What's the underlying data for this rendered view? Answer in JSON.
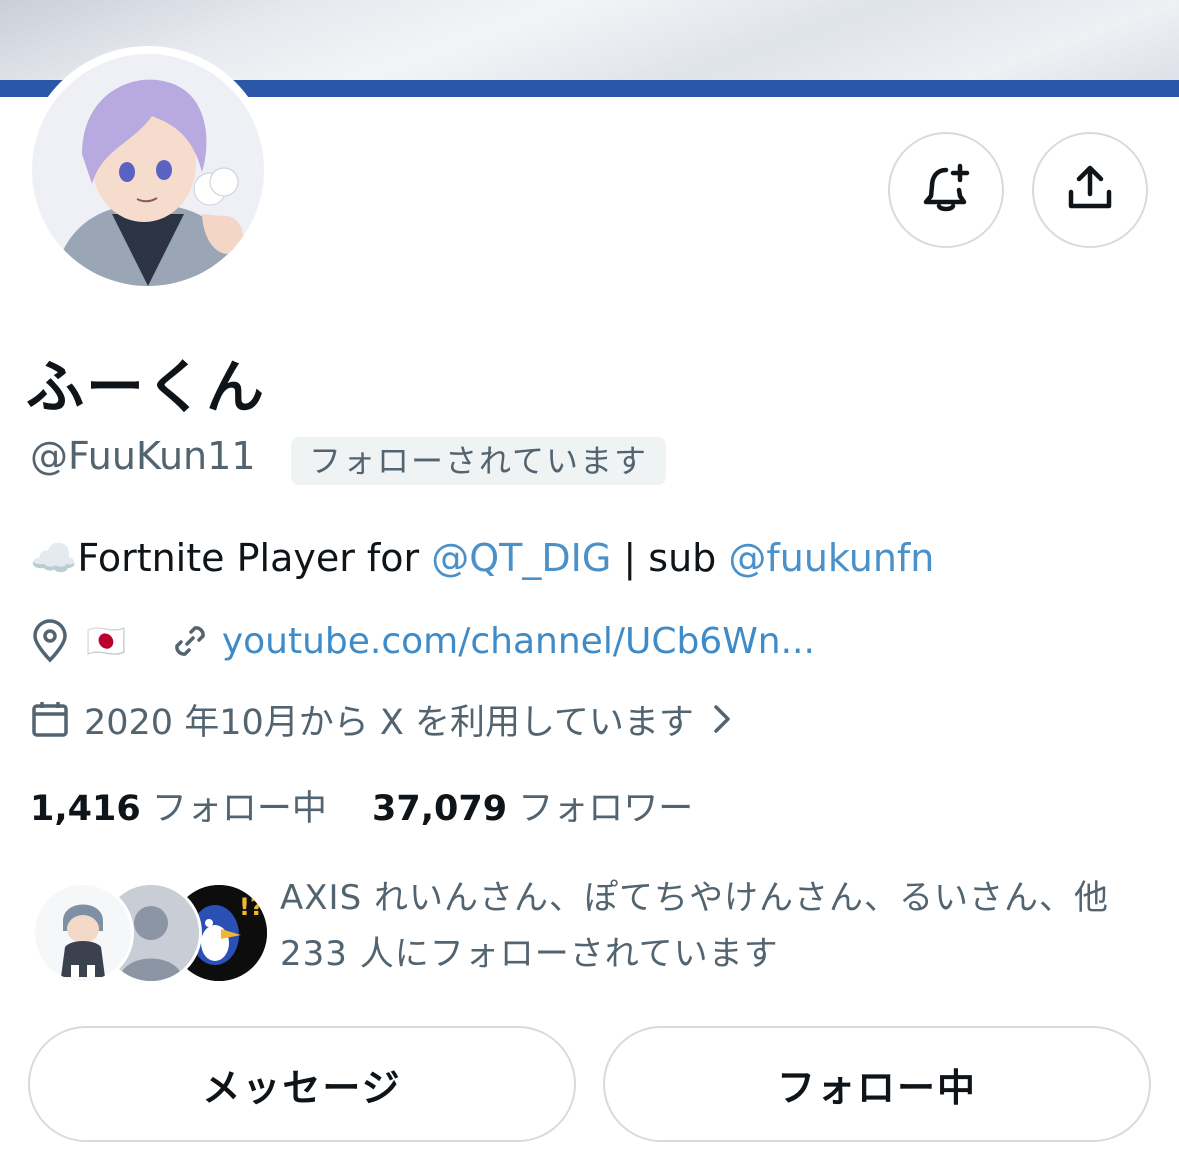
{
  "profile": {
    "display_name": "ふーくん",
    "handle": "@FuuKun11",
    "follows_you_badge": "フォローされています",
    "bio": {
      "emoji": "☁️",
      "text1": "Fortnite Player for ",
      "mention1": "@QT_DIG",
      "text2": " | sub ",
      "mention2": "@fuukunfn"
    },
    "location_flag": "🇯🇵",
    "website": "youtube.com/channel/UCb6Wn...",
    "joined": "2020 年10月から X を利用しています",
    "stats": {
      "following_count": "1,416",
      "following_label": "フォロー中",
      "followers_count": "37,079",
      "followers_label": "フォロワー"
    },
    "followed_by": {
      "line1": "AXIS れいんさん、ぽてちやけんさん、るいさん、他",
      "line2": "233 人にフォローされています"
    }
  },
  "actions": {
    "message_label": "メッセージ",
    "following_label": "フォロー中"
  },
  "icons": {
    "notify": "bell-plus-icon",
    "share": "share-icon",
    "location": "location-pin-icon",
    "link": "link-icon",
    "calendar": "calendar-icon",
    "chevron": "chevron-right-icon"
  },
  "colors": {
    "accent_link": "#3f8bc7",
    "banner_stripe": "#2b57a9",
    "secondary_text": "#536471"
  }
}
